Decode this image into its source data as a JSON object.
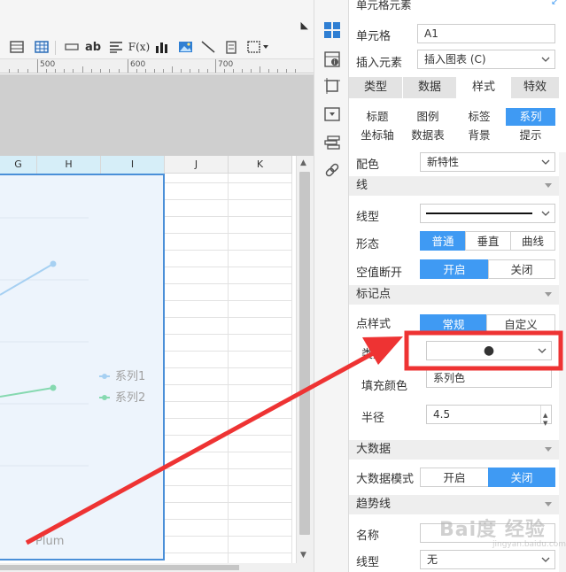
{
  "editor": {
    "toolbar": {
      "icons": [
        "grid-table-icon",
        "table-icon",
        "text-separator-icon",
        "text-ab-icon",
        "align-icon",
        "formula-icon",
        "bar-chart-icon",
        "image-icon",
        "slash-line-icon",
        "frame-icon",
        "border-dropdown-icon"
      ],
      "formula_label": "F(x)",
      "ab_label": "ab"
    },
    "ruler": {
      "labels": [
        "500",
        "600",
        "700"
      ]
    },
    "columns": [
      "G",
      "H",
      "I",
      "J",
      "K"
    ],
    "chart": {
      "legend": [
        "系列1",
        "系列2"
      ],
      "category_label": "Plum",
      "series_colors": [
        "#a6d0f2",
        "#86d9b0"
      ]
    }
  },
  "panel": {
    "header_title": "单元格元素",
    "cell_label": "单元格",
    "cell_value": "A1",
    "insert_label": "插入元素",
    "insert_value": "插入图表 (C)",
    "tabs": [
      "类型",
      "数据",
      "样式",
      "特效"
    ],
    "active_tab": "样式",
    "subtabs_row1": [
      "标题",
      "图例",
      "标签",
      "系列"
    ],
    "subtabs_row2": [
      "坐标轴",
      "数据表",
      "背景",
      "提示"
    ],
    "active_subtab": "系列",
    "color_label": "配色",
    "color_value": "新特性",
    "section_line": "线",
    "line_type_label": "线型",
    "shape_label": "形态",
    "shape_options": [
      "普通",
      "垂直",
      "曲线"
    ],
    "null_break_label": "空值断开",
    "toggle_on": "开启",
    "toggle_off": "关闭",
    "section_marker": "标记点",
    "point_style_label": "点样式",
    "point_style_options": [
      "常规",
      "自定义"
    ],
    "type_label": "类型",
    "marker_symbol": "●",
    "fill_color_label": "填充颜色",
    "fill_color_value": "系列色",
    "radius_label": "半径",
    "radius_value": "4.5",
    "section_bigdata": "大数据",
    "bigdata_mode_label": "大数据模式",
    "section_trend": "趋势线",
    "name_label": "名称",
    "trend_line_type_label": "线型",
    "trend_line_type_value": "无"
  },
  "watermark": {
    "text": "Bai度 经验",
    "sub": "jingyan.baidu.com"
  },
  "colors": {
    "accent": "#3f9af3",
    "annotation_red": "#ee3333",
    "selection_blue": "#4a8fd8"
  }
}
